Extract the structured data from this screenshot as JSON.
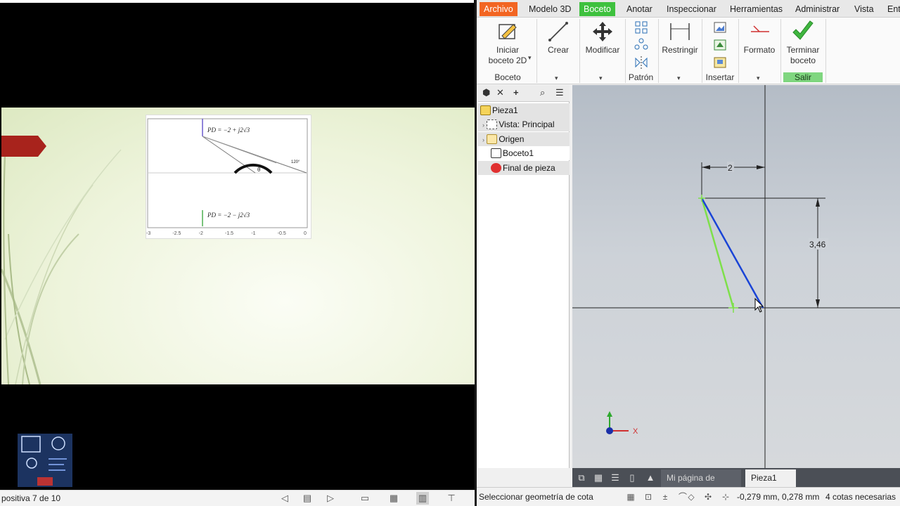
{
  "presentation": {
    "status_text": "positiva 7 de 10",
    "graph": {
      "eq_top": "PD = −2 + j2√3",
      "eq_bottom": "PD = −2 − j2√3",
      "angle_label": "120°",
      "theta": "θ",
      "x_ticks": [
        "-3",
        "-2.5",
        "-2",
        "-1.5",
        "-1",
        "-0.5",
        "0"
      ]
    },
    "nav_buttons": [
      "prev",
      "notes",
      "next",
      "normal-view",
      "slide-sorter",
      "reading-view",
      "slideshow"
    ]
  },
  "inventor": {
    "tabs": [
      "Archivo",
      "Modelo 3D",
      "Boceto",
      "Anotar",
      "Inspeccionar",
      "Herramientas",
      "Administrar",
      "Vista",
      "Ent"
    ],
    "active_tab": "Boceto",
    "ribbon": {
      "start_sketch": {
        "line1": "Iniciar",
        "line2": "boceto 2D"
      },
      "create": "Crear",
      "modify": "Modificar",
      "constrain": "Restringir",
      "format": "Formato",
      "finish": {
        "line1": "Terminar",
        "line2": "boceto"
      },
      "panels": {
        "sketch": "Boceto",
        "pattern": "Patrón",
        "insert": "Insertar",
        "exit": "Salir"
      },
      "dropdown_arrow": "▾"
    },
    "browser": {
      "items": [
        {
          "label": "Pieza1"
        },
        {
          "label": "Vista: Principal"
        },
        {
          "label": "Origen"
        },
        {
          "label": "Boceto1"
        },
        {
          "label": "Final de pieza"
        }
      ]
    },
    "canvas": {
      "dim_horizontal": "2",
      "dim_vertical": "3,46",
      "axis_x": "X"
    },
    "doc_tabs": [
      {
        "label": "Mi página de inic..."
      },
      {
        "label": "Pieza1"
      }
    ],
    "doc_close": "✕",
    "status": {
      "message": "Seleccionar geometría de cota",
      "coordinates": "-0,279 mm, 0,278 mm",
      "dims_needed": "4 cotas necesarias"
    },
    "colors": {
      "file_tab": "#f26522",
      "active_tab": "#3ec13e",
      "line_blue": "#1a44d6",
      "line_green": "#7ee04a"
    }
  }
}
